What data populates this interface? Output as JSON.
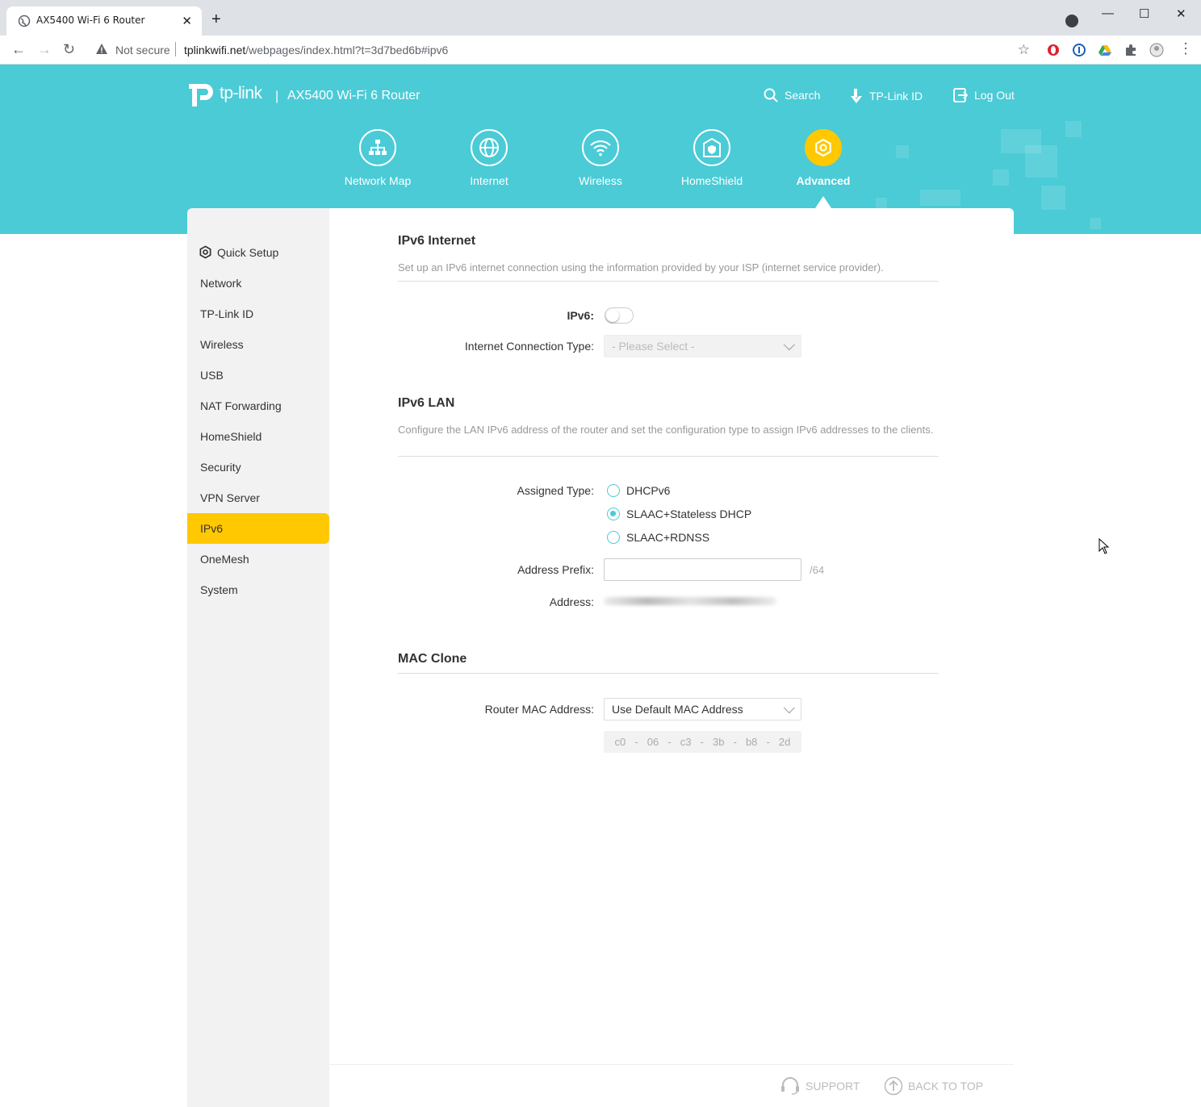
{
  "browser": {
    "tab_title": "AX5400 Wi-Fi 6 Router",
    "security_label": "Not secure",
    "url_host": "tplinkwifi.net",
    "url_path": "/webpages/index.html?t=3d7bed6b#ipv6"
  },
  "header": {
    "brand": "tp-link",
    "separator": "|",
    "model": "AX5400 Wi-Fi 6 Router",
    "links": {
      "search": "Search",
      "tplink_id": "TP-Link ID",
      "logout": "Log Out"
    },
    "nav": [
      {
        "label": "Network Map",
        "icon": "network-map-icon"
      },
      {
        "label": "Internet",
        "icon": "globe-icon"
      },
      {
        "label": "Wireless",
        "icon": "wifi-icon"
      },
      {
        "label": "HomeShield",
        "icon": "home-shield-icon"
      },
      {
        "label": "Advanced",
        "icon": "gear-icon",
        "active": true
      }
    ]
  },
  "sidebar": {
    "items": [
      {
        "label": "Quick Setup",
        "icon": "gear-icon"
      },
      {
        "label": "Network"
      },
      {
        "label": "TP-Link ID"
      },
      {
        "label": "Wireless"
      },
      {
        "label": "USB"
      },
      {
        "label": "NAT Forwarding"
      },
      {
        "label": "HomeShield"
      },
      {
        "label": "Security"
      },
      {
        "label": "VPN Server"
      },
      {
        "label": "IPv6",
        "active": true
      },
      {
        "label": "OneMesh"
      },
      {
        "label": "System"
      }
    ]
  },
  "ipv6_internet": {
    "title": "IPv6 Internet",
    "description": "Set up an IPv6 internet connection using the information provided by your ISP (internet service provider).",
    "ipv6_label": "IPv6:",
    "ipv6_enabled": false,
    "conn_type_label": "Internet Connection Type:",
    "conn_type_placeholder": "- Please Select -"
  },
  "ipv6_lan": {
    "title": "IPv6 LAN",
    "description": "Configure the LAN IPv6 address of the router and set the configuration type to assign IPv6 addresses to the clients.",
    "assigned_type_label": "Assigned Type:",
    "options": [
      {
        "label": "DHCPv6",
        "checked": false
      },
      {
        "label": "SLAAC+Stateless DHCP",
        "checked": true
      },
      {
        "label": "SLAAC+RDNSS",
        "checked": false
      }
    ],
    "prefix_label": "Address Prefix:",
    "prefix_value": "",
    "prefix_suffix": "/64",
    "address_label": "Address:"
  },
  "mac_clone": {
    "title": "MAC Clone",
    "router_mac_label": "Router MAC Address:",
    "router_mac_value": "Use Default MAC Address",
    "mac_octets": [
      "c0",
      "06",
      "c3",
      "3b",
      "b8",
      "2d"
    ],
    "octet_separator": "-"
  },
  "footer": {
    "support": "SUPPORT",
    "back_to_top": "BACK TO TOP"
  },
  "colors": {
    "brand_teal": "#4acbd6",
    "accent_yellow": "#ffc800"
  }
}
